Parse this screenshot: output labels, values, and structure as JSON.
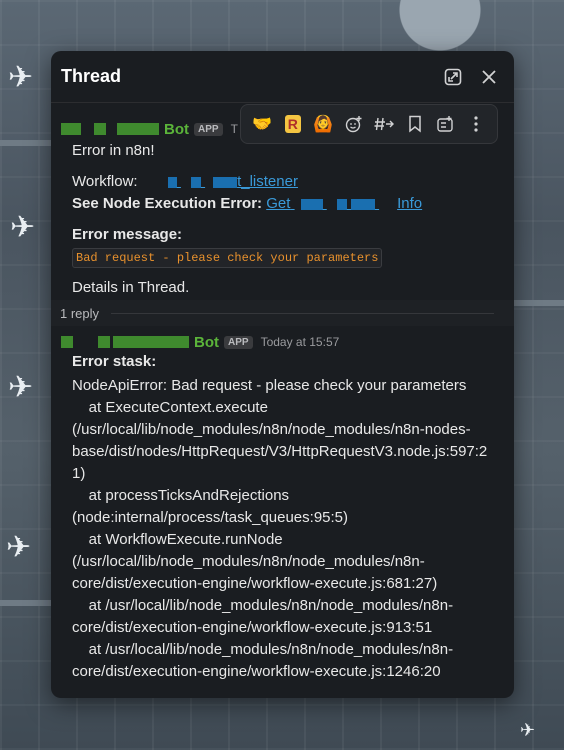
{
  "thread": {
    "title": "Thread"
  },
  "toolbar_icons": [
    "handshake-emoji",
    "r-logo-emoji",
    "person-emoji",
    "add-reaction-icon",
    "hashtag-icon",
    "bookmark-icon",
    "add-list-icon",
    "more-icon"
  ],
  "message1": {
    "author": "Bot",
    "badge": "APP",
    "timestamp_partial": "T",
    "line1": "Error in n8n!",
    "workflow_label": "Workflow:",
    "workflow_link_suffix": "t_listener",
    "node_error_label": "See Node Execution Error:",
    "node_error_link_prefix": "Get",
    "node_error_link_suffix": "Info",
    "error_message_label": "Error message:",
    "error_message_code": "Bad request - please check your parameters",
    "details": "Details in Thread."
  },
  "replies": {
    "count_label": "1 reply"
  },
  "message2": {
    "author": "Bot",
    "badge": "APP",
    "timestamp": "Today at 15:57",
    "heading": "Error stask:",
    "lines": [
      "NodeApiError: Bad request - please check your parameters",
      "    at ExecuteContext.execute",
      "(/usr/local/lib/node_modules/n8n/node_modules/n8n-nodes-",
      "base/dist/nodes/HttpRequest/V3/HttpRequestV3.node.js:597:2",
      "1)",
      "    at processTicksAndRejections",
      "(node:internal/process/task_queues:95:5)",
      "    at WorkflowExecute.runNode",
      "(/usr/local/lib/node_modules/n8n/node_modules/n8n-",
      "core/dist/execution-engine/workflow-execute.js:681:27)",
      "    at /usr/local/lib/node_modules/n8n/node_modules/n8n-",
      "core/dist/execution-engine/workflow-execute.js:913:51",
      "    at /usr/local/lib/node_modules/n8n/node_modules/n8n-",
      "core/dist/execution-engine/workflow-execute.js:1246:20"
    ]
  },
  "colors": {
    "panel_bg": "#1a1d21",
    "bot_name": "#5bb43a",
    "link": "#3a9ad9",
    "code_text": "#e8912d"
  }
}
